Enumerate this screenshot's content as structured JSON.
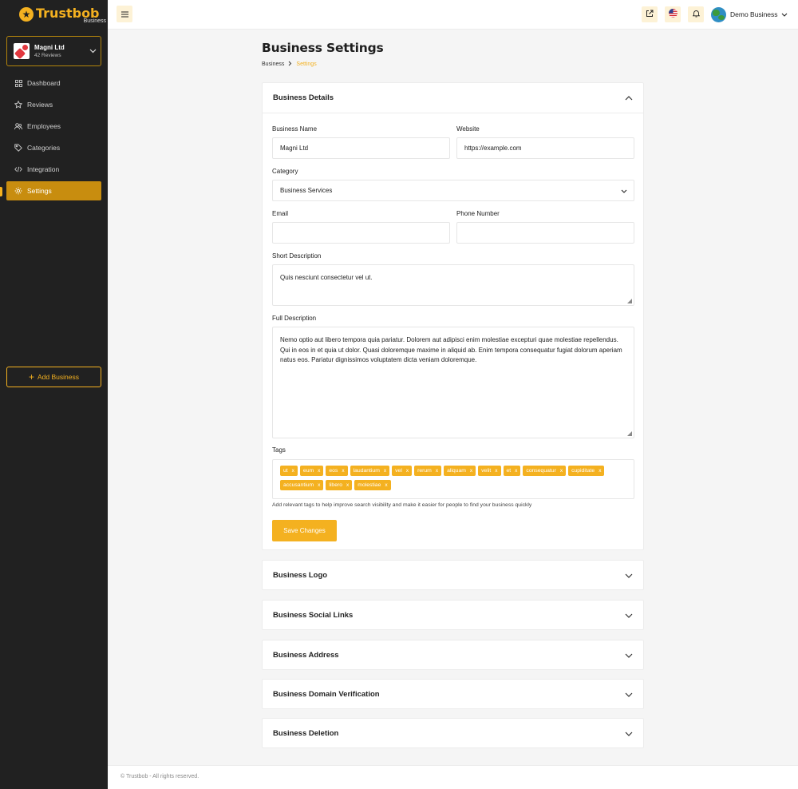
{
  "brand": {
    "name": "Trustbob",
    "sub": "Business",
    "accent": "#f4b120",
    "sidebar_bg": "#212121"
  },
  "business_switcher": {
    "name": "Magni Ltd",
    "reviews": "42 Reviews"
  },
  "sidebar": {
    "items": [
      {
        "label": "Dashboard",
        "icon": "grid-icon"
      },
      {
        "label": "Reviews",
        "icon": "star-icon"
      },
      {
        "label": "Employees",
        "icon": "users-icon"
      },
      {
        "label": "Categories",
        "icon": "tag-icon"
      },
      {
        "label": "Integration",
        "icon": "code-icon"
      },
      {
        "label": "Settings",
        "icon": "gear-icon",
        "active": true
      }
    ],
    "add_business_label": "Add Business"
  },
  "topbar": {
    "user_name": "Demo Business"
  },
  "page": {
    "title": "Business Settings",
    "breadcrumb": [
      "Business",
      "Settings"
    ]
  },
  "details": {
    "title": "Business Details",
    "business_name_label": "Business Name",
    "business_name_value": "Magni Ltd",
    "website_label": "Website",
    "website_value": "https://example.com",
    "category_label": "Category",
    "category_value": "Business Services",
    "email_label": "Email",
    "email_value": "",
    "phone_label": "Phone Number",
    "phone_value": "",
    "short_desc_label": "Short Description",
    "short_desc_value": "Quis nesciunt consectetur vel ut.",
    "full_desc_label": "Full Description",
    "full_desc_value": "Nemo optio aut libero tempora quia pariatur. Dolorem aut adipisci enim molestiae excepturi quae molestiae repellendus. Qui in eos in et quia ut dolor. Quasi doloremque maxime in aliquid ab. Enim tempora consequatur fugiat dolorum aperiam natus eos. Pariatur dignissimos voluptatem dicta veniam doloremque.",
    "tags_label": "Tags",
    "tags": [
      "ut",
      "eum",
      "eos",
      "laudantium",
      "vel",
      "rerum",
      "aliquam",
      "velit",
      "et",
      "consequatur",
      "cupiditate",
      "accusantium",
      "libero",
      "molestiae"
    ],
    "tag_remove": "x",
    "tags_hint": "Add relevant tags to help improve search visibility and make it easier for people to find your business quickly",
    "save_label": "Save Changes"
  },
  "sections": [
    "Business Logo",
    "Business Social Links",
    "Business Address",
    "Business Domain Verification",
    "Business Deletion"
  ],
  "footer": {
    "text": "© Trustbob - All rights reserved."
  }
}
